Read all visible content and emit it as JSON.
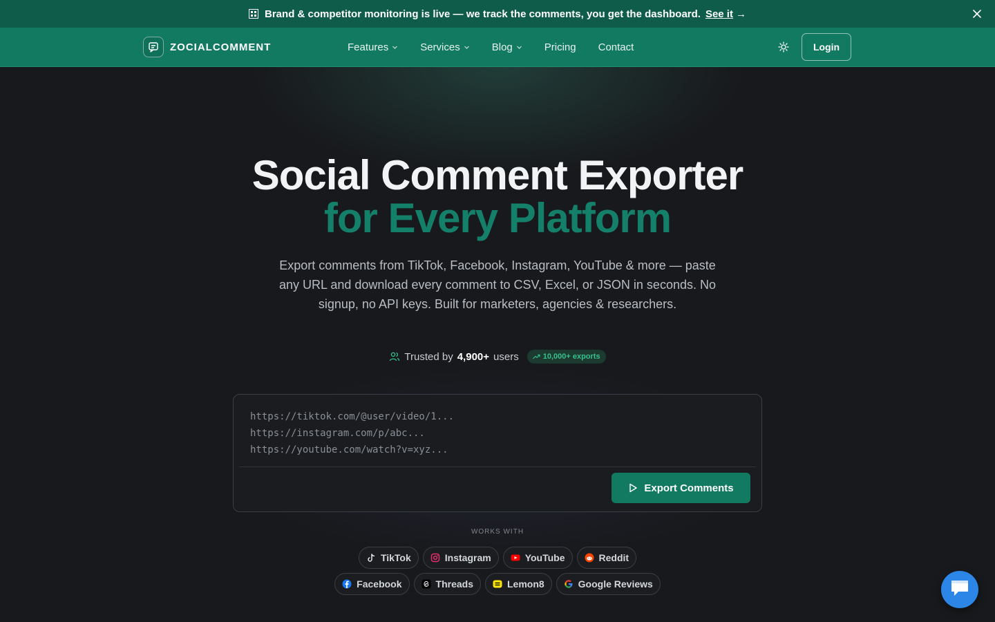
{
  "announcement": {
    "text": "Brand & competitor monitoring is live — we track the comments, you get the dashboard.",
    "link": "See it",
    "arrow": "→"
  },
  "brand": {
    "name": "ZOCIALCOMMENT"
  },
  "nav": {
    "items": [
      {
        "label": "Features",
        "has_dropdown": true
      },
      {
        "label": "Services",
        "has_dropdown": true
      },
      {
        "label": "Blog",
        "has_dropdown": true
      },
      {
        "label": "Pricing",
        "has_dropdown": false
      },
      {
        "label": "Contact",
        "has_dropdown": false
      }
    ],
    "login": "Login"
  },
  "hero": {
    "title_line1": "Social Comment Exporter",
    "title_line2": "for Every Platform",
    "subtitle": "Export comments from TikTok, Facebook, Instagram, YouTube & more — paste any URL and download every comment to CSV, Excel, or JSON in seconds. No signup, no API keys. Built for marketers, agencies & researchers.",
    "trust_prefix": "Trusted by",
    "trust_count": "4,900+",
    "trust_suffix": "users",
    "trust_badge": "10,000+ exports"
  },
  "url_input": {
    "placeholder": "https://tiktok.com/@user/video/1...\nhttps://instagram.com/p/abc...\nhttps://youtube.com/watch?v=xyz...",
    "export_button": "Export Comments"
  },
  "works_with": {
    "label": "WORKS WITH",
    "row1": [
      {
        "label": "TikTok",
        "icon": "tiktok-icon"
      },
      {
        "label": "Instagram",
        "icon": "instagram-icon"
      },
      {
        "label": "YouTube",
        "icon": "youtube-icon"
      },
      {
        "label": "Reddit",
        "icon": "reddit-icon"
      }
    ],
    "row2": [
      {
        "label": "Facebook",
        "icon": "facebook-icon"
      },
      {
        "label": "Threads",
        "icon": "threads-icon"
      },
      {
        "label": "Lemon8",
        "icon": "lemon8-icon"
      },
      {
        "label": "Google Reviews",
        "icon": "google-icon"
      }
    ]
  },
  "colors": {
    "accent": "#137a62",
    "announcement_bg": "#0f5c4b",
    "title_green": "#15806a",
    "background": "#18191c",
    "chat_blue": "#2b86e8"
  }
}
